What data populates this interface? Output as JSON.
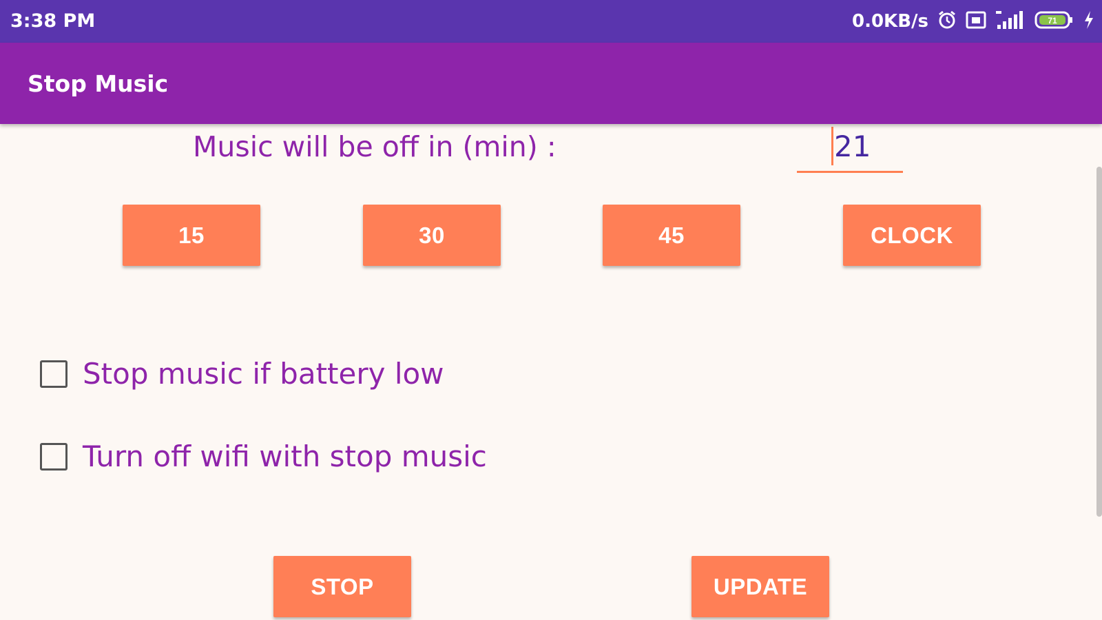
{
  "status_bar": {
    "time": "3:38 PM",
    "net_speed": "0.0KB/s",
    "battery_level": "71",
    "icons": [
      "alarm-icon",
      "sim-icon",
      "signal-icon",
      "battery-icon",
      "charging-icon"
    ]
  },
  "app_bar": {
    "title": "Stop Music"
  },
  "timer": {
    "label": "Music will be off in (min) :",
    "value": "21"
  },
  "presets": [
    "15",
    "30",
    "45",
    "CLOCK"
  ],
  "options": [
    {
      "label": "Stop music if battery low",
      "checked": false
    },
    {
      "label": "Turn off wifi with stop music",
      "checked": false
    }
  ],
  "actions": {
    "stop_label": "STOP",
    "update_label": "UPDATE"
  },
  "colors": {
    "status_bar": "#5a35ae",
    "app_bar": "#8e24aa",
    "accent": "#ff7f56",
    "text_primary": "#8e24aa",
    "background": "#fdf8f4"
  }
}
